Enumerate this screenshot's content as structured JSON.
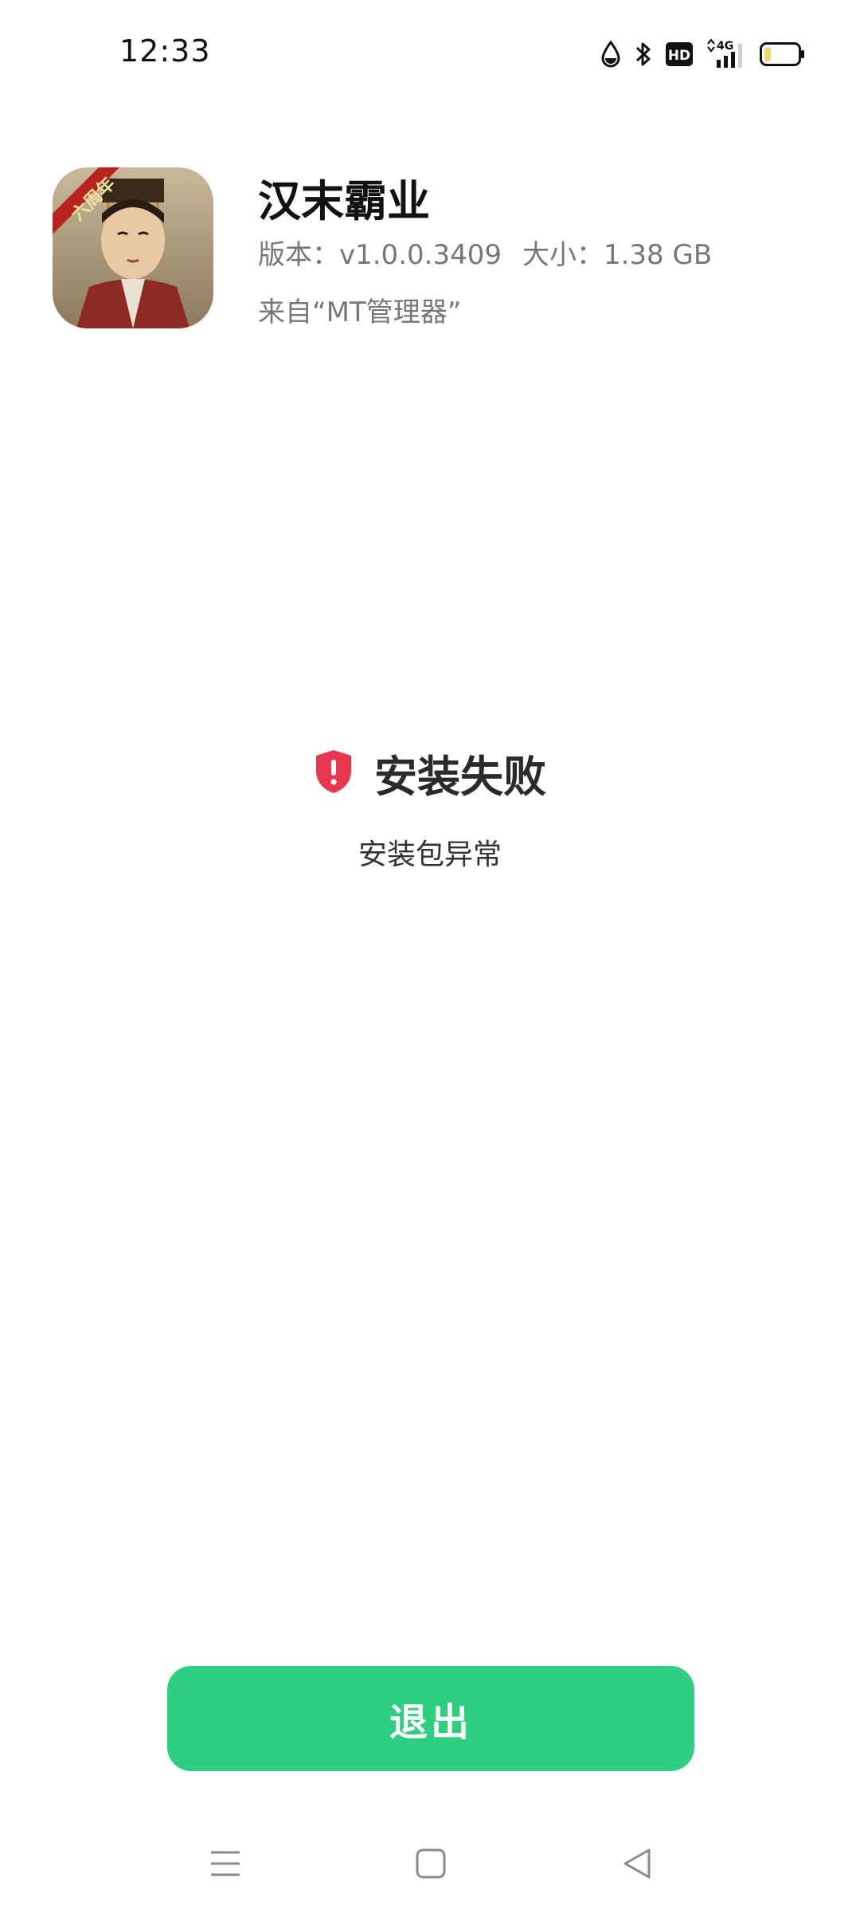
{
  "status_bar": {
    "time": "12:33",
    "network_label": "4G",
    "hd_label": "HD",
    "icons": [
      "water-drop-icon",
      "bluetooth-icon",
      "hd-icon",
      "signal-4g-icon",
      "battery-icon"
    ],
    "battery_level": 0.2,
    "battery_color": "#f2d66b"
  },
  "app": {
    "name": "汉末霸业",
    "version": "版本：v1.0.0.3409",
    "size": "大小：1.38 GB",
    "source": "来自“MT管理器”",
    "icon_badge": "六周年"
  },
  "result": {
    "title": "安装失败",
    "description": "安装包异常",
    "icon": "shield-alert-icon",
    "icon_color": "#e8384f"
  },
  "actions": {
    "exit_label": "退出",
    "exit_color": "#2ecf80"
  },
  "nav_bar": {
    "icons": [
      "menu-icon",
      "home-icon",
      "back-icon"
    ]
  }
}
